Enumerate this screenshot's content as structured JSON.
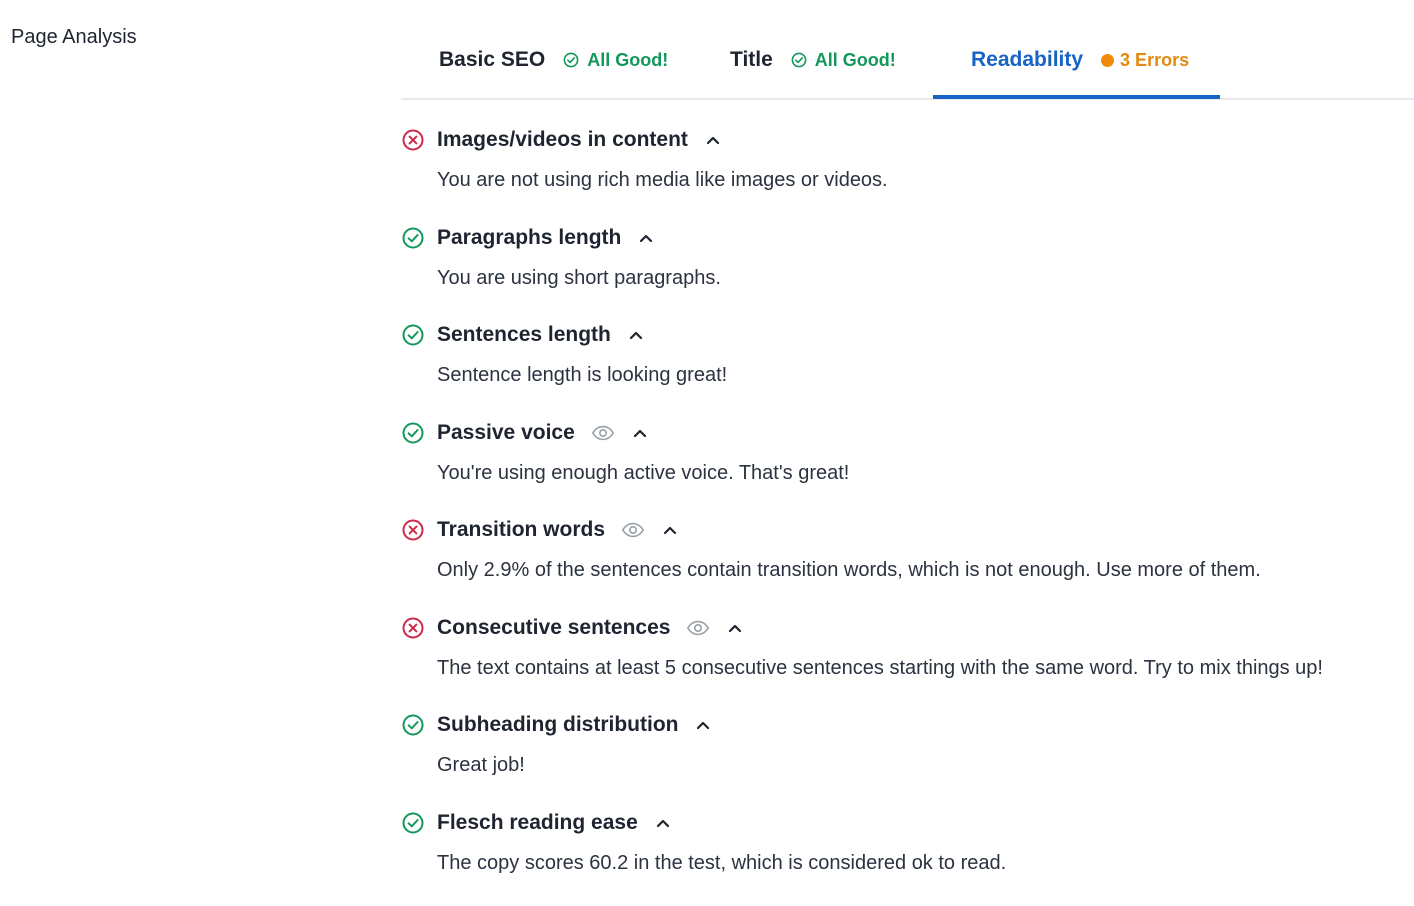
{
  "page_label": "Page Analysis",
  "tabs": [
    {
      "label": "Basic SEO",
      "status": "All Good!",
      "status_type": "good"
    },
    {
      "label": "Title",
      "status": "All Good!",
      "status_type": "good"
    },
    {
      "label": "Readability",
      "status": "3 Errors",
      "status_type": "warn",
      "active": true
    }
  ],
  "checks": [
    {
      "title": "Images/videos in content",
      "status": "error",
      "has_eye": false,
      "description": "You are not using rich media like images or videos."
    },
    {
      "title": "Paragraphs length",
      "status": "ok",
      "has_eye": false,
      "description": "You are using short paragraphs."
    },
    {
      "title": "Sentences length",
      "status": "ok",
      "has_eye": false,
      "description": "Sentence length is looking great!"
    },
    {
      "title": "Passive voice",
      "status": "ok",
      "has_eye": true,
      "description": "You're using enough active voice. That's great!"
    },
    {
      "title": "Transition words",
      "status": "error",
      "has_eye": true,
      "description": "Only 2.9% of the sentences contain transition words, which is not enough. Use more of them."
    },
    {
      "title": "Consecutive sentences",
      "status": "error",
      "has_eye": true,
      "description": "The text contains at least 5 consecutive sentences starting with the same word. Try to mix things up!"
    },
    {
      "title": "Subheading distribution",
      "status": "ok",
      "has_eye": false,
      "description": "Great job!"
    },
    {
      "title": "Flesch reading ease",
      "status": "ok",
      "has_eye": false,
      "description": "The copy scores 60.2 in the test, which is considered ok to read."
    }
  ],
  "colors": {
    "accent": "#1763c6",
    "good": "#12985b",
    "error": "#d0284a",
    "warn": "#e38a12"
  }
}
